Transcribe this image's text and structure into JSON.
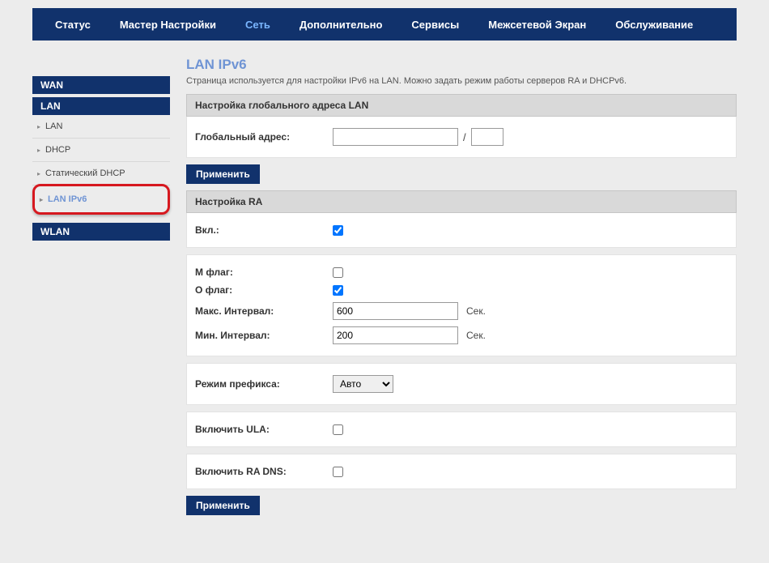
{
  "nav": {
    "items": [
      "Статус",
      "Мастер Настройки",
      "Сеть",
      "Дополнительно",
      "Сервисы",
      "Межсетевой Экран",
      "Обслуживание"
    ],
    "activeIndex": 2
  },
  "sidebar": {
    "sections": {
      "wan": "WAN",
      "lan": "LAN",
      "wlan": "WLAN"
    },
    "lanItems": [
      "LAN",
      "DHCP",
      "Статический DHCP",
      "LAN IPv6"
    ],
    "activeLanItem": "LAN IPv6"
  },
  "page": {
    "title": "LAN IPv6",
    "desc": "Страница используется для настройки IPv6 на LAN. Можно задать режим работы серверов RA и DHCPv6."
  },
  "sections": {
    "globalAddr": {
      "header": "Настройка глобального адреса LAN",
      "label": "Глобальный адрес:",
      "addrValue": "",
      "prefixValue": ""
    },
    "ra": {
      "header": "Настройка RA",
      "enableLabel": "Вкл.:",
      "enableChecked": true,
      "mFlagLabel": "M флаг:",
      "mFlagChecked": false,
      "oFlagLabel": "O флаг:",
      "oFlagChecked": true,
      "maxIntervalLabel": "Макс. Интервал:",
      "maxIntervalValue": "600",
      "minIntervalLabel": "Мин. Интервал:",
      "minIntervalValue": "200",
      "unitSec": "Сек.",
      "prefixModeLabel": "Режим префикса:",
      "prefixModeValue": "Авто",
      "ulaLabel": "Включить ULA:",
      "ulaChecked": false,
      "raDnsLabel": "Включить RA DNS:",
      "raDnsChecked": false
    }
  },
  "buttons": {
    "apply": "Применить"
  }
}
